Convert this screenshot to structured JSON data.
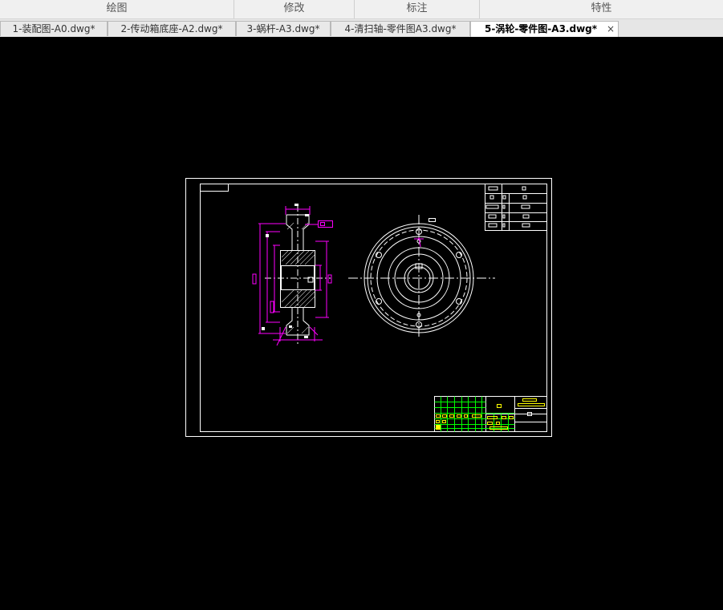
{
  "ribbon": {
    "groups": [
      "绘图",
      "修改",
      "标注",
      "特性"
    ]
  },
  "tabs": [
    {
      "label": "1-装配图-A0.dwg*"
    },
    {
      "label": "2-传动箱底座-A2.dwg*"
    },
    {
      "label": "3-蜗杆-A3.dwg*"
    },
    {
      "label": "4-清扫轴-零件图A3.dwg*"
    },
    {
      "label": "5-涡轮-零件图-A3.dwg*",
      "active": true,
      "close": "×"
    }
  ],
  "icons": {
    "close": "close-icon"
  },
  "colors": {
    "canvas_bg": "#000000",
    "frame": "#ffffff",
    "dimension": "#ff00ff",
    "title_block_grid": "#00ff00",
    "title_block_text": "#ffff00",
    "hatch": "#ffffff"
  }
}
